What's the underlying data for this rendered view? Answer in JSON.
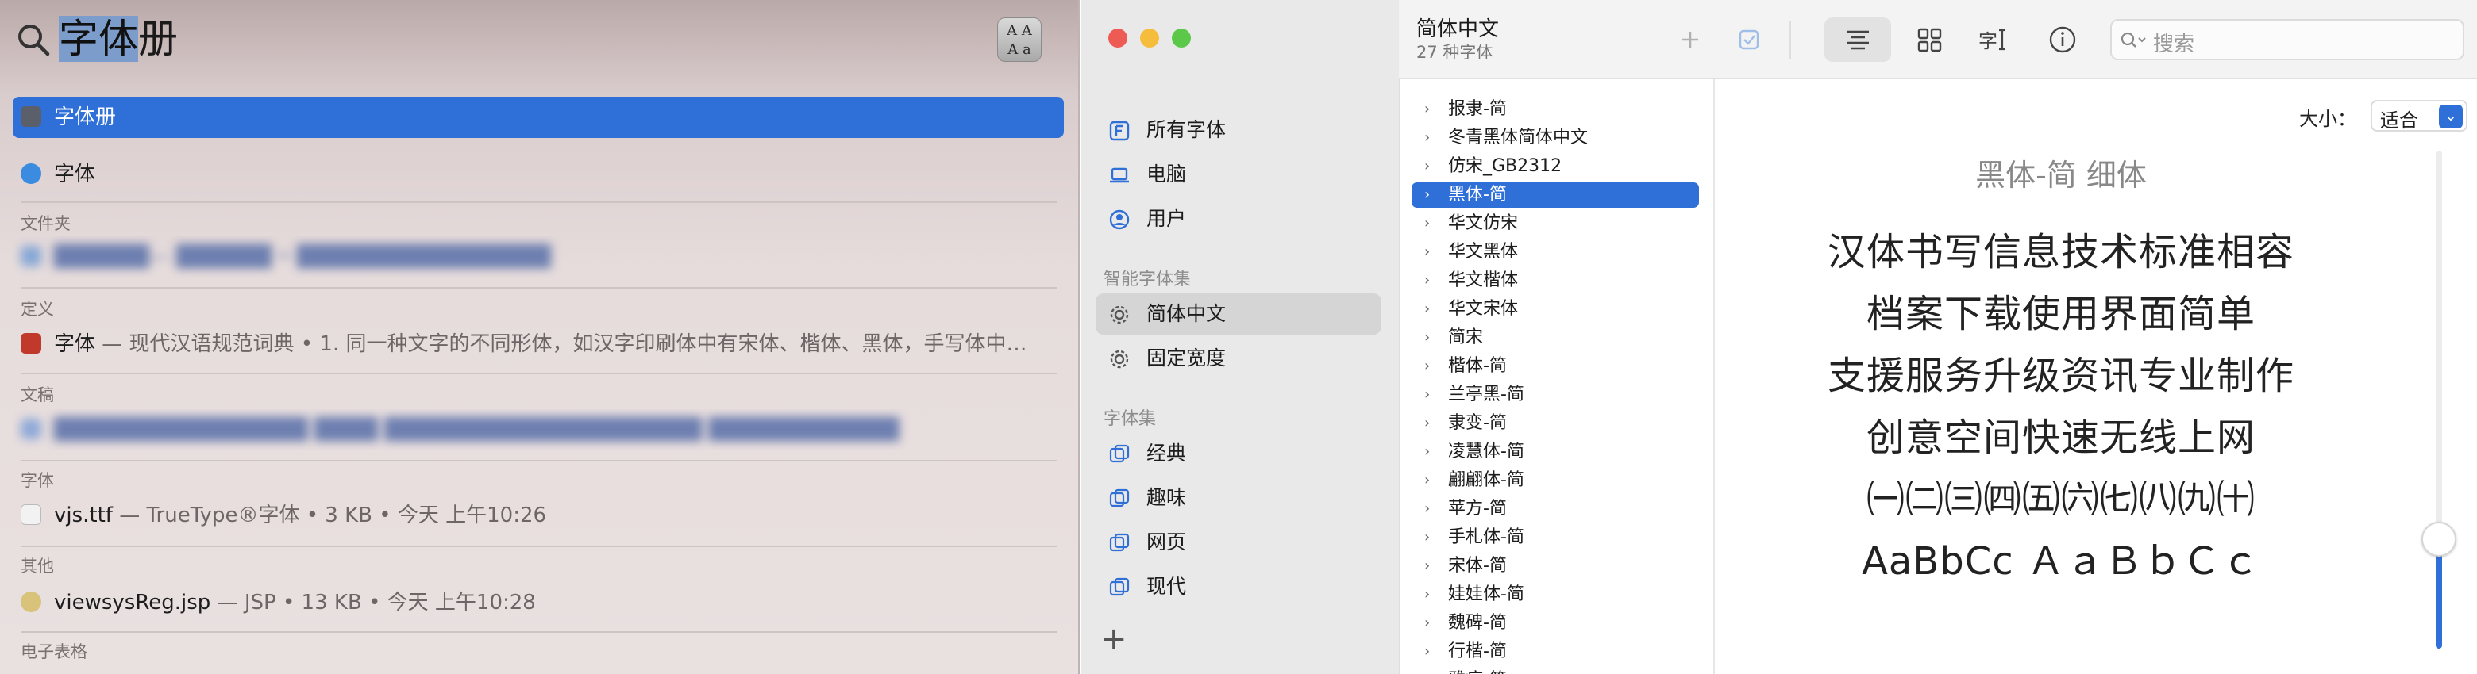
{
  "spotlight": {
    "query_selected": "字体",
    "query_rest": "册",
    "rows": [
      {
        "title": "字体册",
        "subtitle": ""
      },
      {
        "title": "字体",
        "subtitle": ""
      }
    ],
    "sections": [
      {
        "header": "文件夹",
        "items": [
          {
            "title": "██████",
            "subtitle": "— ██████ • ████████████████"
          }
        ]
      },
      {
        "header": "定义",
        "items": [
          {
            "title": "字体",
            "subtitle": " — 现代汉语规范词典 • 1. 同一种文字的不同形体，如汉字印刷体中有宋体、楷体、黑体，手写体中…"
          }
        ]
      },
      {
        "header": "文稿",
        "items": [
          {
            "title": "████████████████ ████ ████████████████████ ████████████",
            "subtitle": ""
          }
        ]
      },
      {
        "header": "字体",
        "items": [
          {
            "title": "vjs.ttf",
            "subtitle": " — TrueType®字体 • 3 KB • 今天 上午10:26"
          }
        ]
      },
      {
        "header": "其他",
        "items": [
          {
            "title": "viewsysReg.jsp",
            "subtitle": " — JSP • 13 KB • 今天 上午10:28"
          }
        ]
      },
      {
        "header": "电子表格",
        "items": []
      }
    ]
  },
  "sidebar": {
    "top_items": [
      {
        "label": "所有字体",
        "icon": "font-f-icon"
      },
      {
        "label": "电脑",
        "icon": "laptop-icon"
      },
      {
        "label": "用户",
        "icon": "user-icon"
      }
    ],
    "smart_header": "智能字体集",
    "smart_items": [
      {
        "label": "简体中文",
        "icon": "gear-icon"
      },
      {
        "label": "固定宽度",
        "icon": "gear-icon"
      }
    ],
    "collections_header": "字体集",
    "collection_items": [
      {
        "label": "经典",
        "icon": "collection-icon"
      },
      {
        "label": "趣味",
        "icon": "collection-icon"
      },
      {
        "label": "网页",
        "icon": "collection-icon"
      },
      {
        "label": "现代",
        "icon": "collection-icon"
      }
    ],
    "add_label": "+"
  },
  "toolbar": {
    "title": "简体中文",
    "subtitle": "27 种字体",
    "search_placeholder": "搜索"
  },
  "font_list": {
    "selected_index": 3,
    "items": [
      "报隶-简",
      "冬青黑体简体中文",
      "仿宋_GB2312",
      "黑体-简",
      "华文仿宋",
      "华文黑体",
      "华文楷体",
      "华文宋体",
      "简宋",
      "楷体-简",
      "兰亭黑-简",
      "隶变-简",
      "凌慧体-简",
      "翩翩体-简",
      "苹方-简",
      "手札体-简",
      "宋体-简",
      "娃娃体-简",
      "魏碑-简",
      "行楷-简",
      "雅痞-简"
    ]
  },
  "preview": {
    "size_label": "大小：",
    "size_value": "适合",
    "font_name": "黑体-简 细体",
    "lines": [
      "汉体书写信息技术标准相容",
      "档案下载使用界面简单",
      "支援服务升级资讯专业制作",
      "创意空间快速无线上网",
      "㈠㈡㈢㈣㈤㈥㈦㈧㈨㈩",
      "AaBbCc ＡａＢｂＣｃ"
    ],
    "size_slider_level": 0.22
  },
  "colors": {
    "accent": "#2f6fd8",
    "traffic_close": "#ee5b55",
    "traffic_min": "#f5bd3b",
    "traffic_max": "#5bc84a"
  }
}
